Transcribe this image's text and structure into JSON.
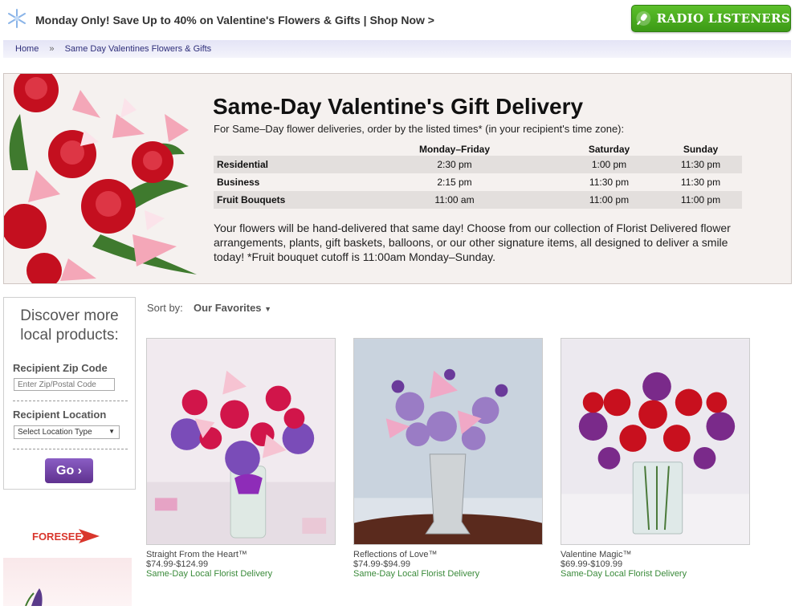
{
  "promo": {
    "text": "Monday Only! Save Up to 40% on Valentine's Flowers & Gifts | Shop Now >"
  },
  "radio_button": {
    "label": "RADIO LISTENERS"
  },
  "breadcrumb": {
    "home": "Home",
    "separator": "»",
    "current": "Same Day Valentines Flowers & Gifts"
  },
  "hero": {
    "title": "Same-Day Valentine's Gift Delivery",
    "subtitle": "For Same–Day flower deliveries, order by the listed times* (in your recipient's time zone):",
    "schedule": {
      "headers": [
        "",
        "Monday–Friday",
        "Saturday",
        "Sunday"
      ],
      "rows": [
        {
          "label": "Residential",
          "times": [
            "2:30 pm",
            "1:00 pm",
            "11:30 pm"
          ]
        },
        {
          "label": "Business",
          "times": [
            "2:15 pm",
            "11:30 pm",
            "11:30 pm"
          ]
        },
        {
          "label": "Fruit Bouquets",
          "times": [
            "11:00 am",
            "11:00 pm",
            "11:00 pm"
          ]
        }
      ]
    },
    "body": "Your flowers will be hand-delivered that same day! Choose from our collection of Florist Delivered flower arrangements, plants, gift baskets, balloons, or our other signature items, all designed to deliver a smile today! *Fruit bouquet cutoff is 11:00am Monday–Sunday."
  },
  "sidebar": {
    "discover_line1": "Discover more",
    "discover_line2": "local products:",
    "zip_label": "Recipient Zip Code",
    "zip_placeholder": "Enter Zip/Postal Code",
    "location_label": "Recipient Location",
    "location_value": "Select Location Type",
    "go_label": "Go",
    "foresee_label": "FORESEE"
  },
  "sort": {
    "label": "Sort by:",
    "value": "Our Favorites"
  },
  "products": [
    {
      "name": "Straight From the Heart™",
      "price": "$74.99-$124.99",
      "delivery": "Same-Day Local Florist Delivery"
    },
    {
      "name": "Reflections of Love™",
      "price": "$74.99-$94.99",
      "delivery": "Same-Day Local Florist Delivery"
    },
    {
      "name": "Valentine Magic™",
      "price": "$69.99-$109.99",
      "delivery": "Same-Day Local Florist Delivery"
    }
  ],
  "colors": {
    "accent_purple": "#5f318f",
    "radio_green": "#4aab1f",
    "delivery_green": "#3a8a3a"
  }
}
